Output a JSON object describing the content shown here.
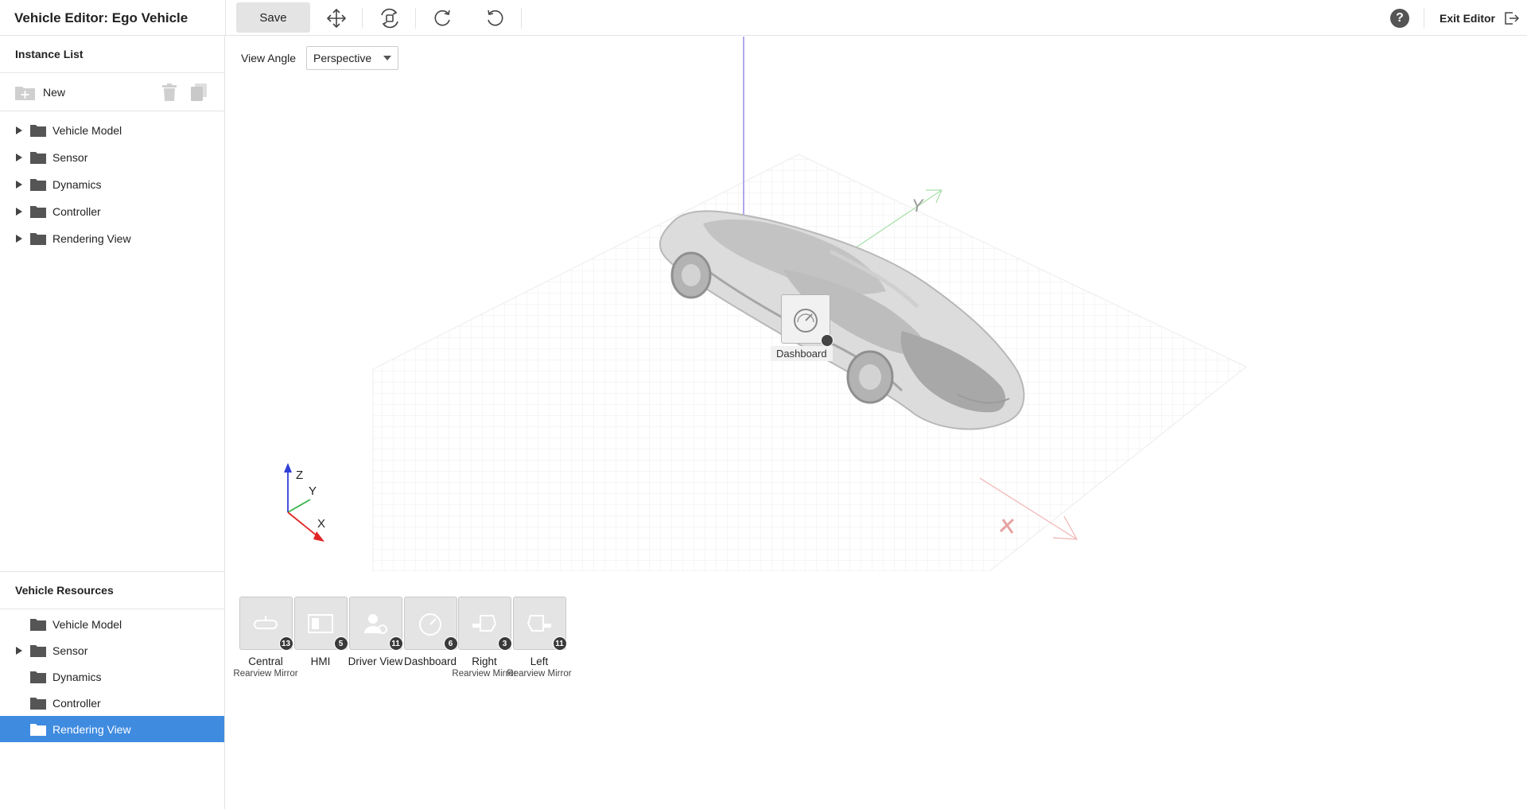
{
  "header": {
    "title": "Vehicle Editor: Ego Vehicle",
    "save_label": "Save",
    "help_label": "?",
    "exit_label": "Exit Editor",
    "tools": [
      "move-icon",
      "rotate-view-icon",
      "rotate-clockwise-icon",
      "rotate-counterclockwise-icon"
    ]
  },
  "instance_list": {
    "title": "Instance List",
    "new_label": "New",
    "items": [
      {
        "label": "Vehicle Model",
        "expandable": true
      },
      {
        "label": "Sensor",
        "expandable": true
      },
      {
        "label": "Dynamics",
        "expandable": true
      },
      {
        "label": "Controller",
        "expandable": true
      },
      {
        "label": "Rendering View",
        "expandable": true
      }
    ]
  },
  "viewport": {
    "view_angle_label": "View Angle",
    "view_angle_value": "Perspective",
    "marker_label": "Dashboard",
    "axis_labels": {
      "z": "Z",
      "y": "Y",
      "x": "X"
    },
    "axis_colors": {
      "x": "#e02424",
      "y": "#3cb34a",
      "z": "#2f3fd6"
    }
  },
  "vehicle_resources": {
    "title": "Vehicle Resources",
    "items": [
      {
        "label": "Vehicle Model",
        "expandable": false
      },
      {
        "label": "Sensor",
        "expandable": true
      },
      {
        "label": "Dynamics",
        "expandable": false
      },
      {
        "label": "Controller",
        "expandable": false
      },
      {
        "label": "Rendering View",
        "expandable": false,
        "selected": true
      }
    ]
  },
  "resources": [
    {
      "name": "Central",
      "sub": "Rearview Mirror",
      "count": "13",
      "icon": "rearview-mirror-icon"
    },
    {
      "name": "HMI",
      "sub": "",
      "count": "5",
      "icon": "hmi-icon"
    },
    {
      "name": "Driver View",
      "sub": "",
      "count": "11",
      "icon": "driver-view-icon"
    },
    {
      "name": "Dashboard",
      "sub": "",
      "count": "6",
      "icon": "dashboard-gauge-icon"
    },
    {
      "name": "Right",
      "sub": "Rearview Mirror",
      "count": "3",
      "icon": "right-mirror-icon"
    },
    {
      "name": "Left",
      "sub": "Rearview Mirror",
      "count": "11",
      "icon": "left-mirror-icon"
    }
  ],
  "colors": {
    "accent": "#3f8be0",
    "tile": "#e4e4e4",
    "badge": "#3a3a3a"
  }
}
